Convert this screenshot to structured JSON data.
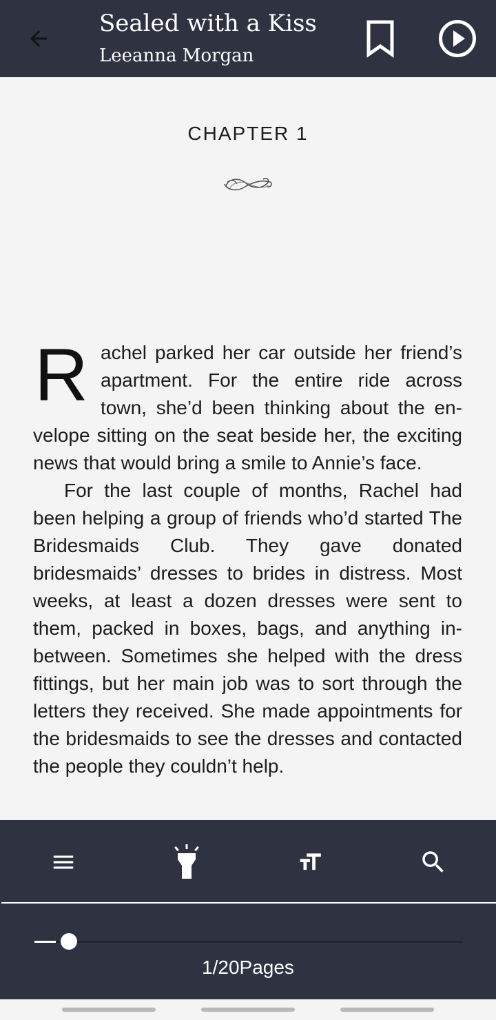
{
  "header": {
    "title": "Sealed with a Kiss",
    "author": "Leeanna Morgan",
    "back_icon": "arrow-left-icon",
    "bookmark_icon": "bookmark-outline-icon",
    "play_icon": "play-circle-icon"
  },
  "content": {
    "chapter_title": "CHAPTER 1",
    "ornament_icon": "flourish-ornament-icon",
    "drop_cap": "R",
    "paragraph_1_rest": "achel parked her car outside her friend’s apartment. For the entire ride across town, she’d been thinking about the en­velope sitting on the seat beside her, the excit­ing news that would bring a smile to Annie’s face.",
    "paragraph_2": "For the last couple of months, Rachel had been helping a group of friends who’d started The Bridesmaids Club. They gave donated bridesmaids’ dresses to brides in distress. Most weeks, at least a dozen dresses were sent to them, packed in boxes, bags, and any­thing in-between. Sometimes she helped with the dress fittings, but her main job was to sort through the letters they received. She made appointments for the bridesmaids to see the dresses and contacted the people they couldn’t help."
  },
  "toolbar": {
    "items": [
      {
        "name": "table-of-contents",
        "icon": "menu-icon"
      },
      {
        "name": "brightness",
        "icon": "flashlight-icon"
      },
      {
        "name": "text-size",
        "icon": "text-size-icon"
      },
      {
        "name": "search",
        "icon": "search-icon"
      }
    ]
  },
  "progress": {
    "current_page": 1,
    "total_pages": 20,
    "fraction": 0.05,
    "label": "1/20Pages"
  },
  "colors": {
    "bar_background": "#2f3241",
    "page_background": "#f4f4f4",
    "text": "#1d1d1d",
    "accent": "#ffffff"
  }
}
